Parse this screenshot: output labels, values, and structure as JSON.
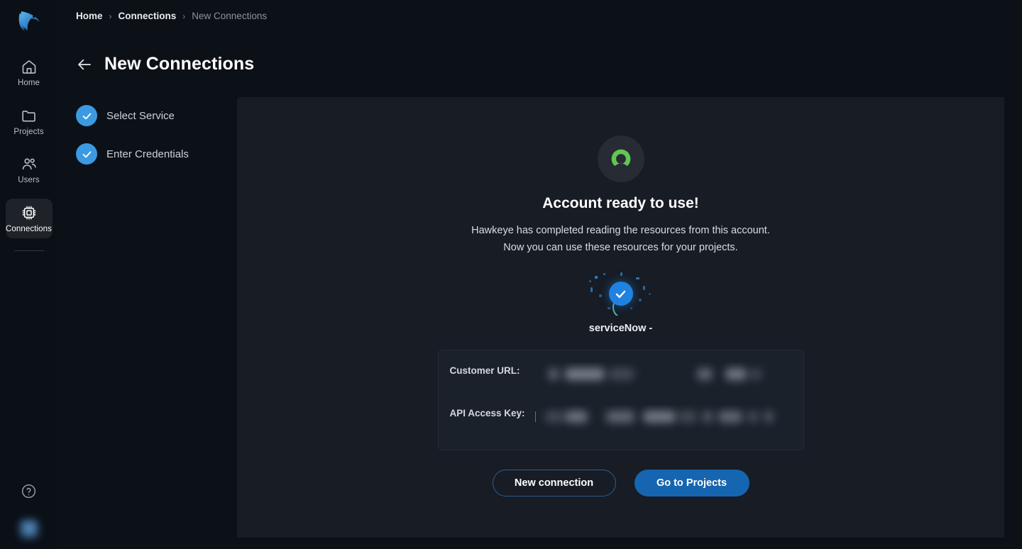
{
  "colors": {
    "accent": "#3b9ae1",
    "primary_button": "#1665b0",
    "sidebar_bg": "#0b1017",
    "main_bg": "#0c1118",
    "panel_bg": "#171c25",
    "card_bg": "#1b212b",
    "servicenow_green": "#62c554"
  },
  "sidebar": {
    "logo_name": "hawkeye-logo",
    "items": [
      {
        "label": "Home",
        "icon": "home-icon",
        "active": false
      },
      {
        "label": "Projects",
        "icon": "folder-icon",
        "active": false
      },
      {
        "label": "Users",
        "icon": "users-icon",
        "active": false
      },
      {
        "label": "Connections",
        "icon": "chip-icon",
        "active": true
      }
    ],
    "help_label": "Help",
    "avatar_label": "User avatar"
  },
  "breadcrumb": {
    "items": [
      {
        "label": "Home"
      },
      {
        "label": "Connections"
      },
      {
        "label": "New Connections"
      }
    ],
    "separator": "›"
  },
  "header": {
    "title": "New Connections",
    "back_label": "Back"
  },
  "steps": [
    {
      "label": "Select Service",
      "completed": true
    },
    {
      "label": "Enter Credentials",
      "completed": true
    }
  ],
  "content": {
    "service_icon": "servicenow-logo-icon",
    "title": "Account ready to use!",
    "subtitle_line1": "Hawkeye has completed reading the resources from this account.",
    "subtitle_line2": "Now you can use these resources for your projects.",
    "success_icon": "success-check-icon",
    "service_name": "serviceNow -",
    "credentials": [
      {
        "label": "Customer URL:",
        "value": "",
        "redacted": true
      },
      {
        "label": "API Access Key:",
        "value": "",
        "redacted": true
      }
    ],
    "buttons": {
      "secondary": "New connection",
      "primary": "Go to Projects"
    }
  }
}
